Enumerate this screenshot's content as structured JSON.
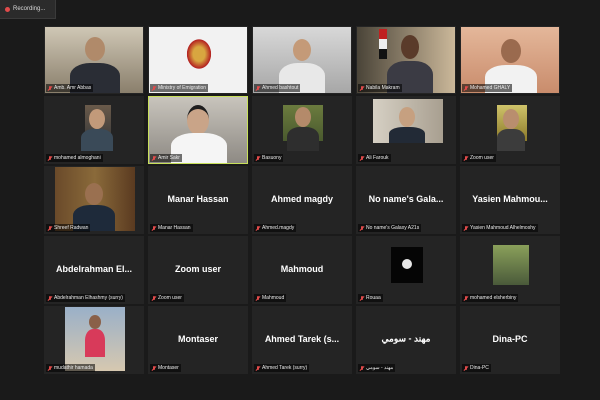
{
  "recording": {
    "label": "Recording..."
  },
  "participants": [
    {
      "label": "Amb. Amr Abbas",
      "name": "",
      "video": true,
      "muted": true
    },
    {
      "label": "Ministry of Emigration",
      "name": "",
      "video": true,
      "muted": true
    },
    {
      "label": "Ahmed bashtout",
      "name": "",
      "video": true,
      "muted": true
    },
    {
      "label": "Nabila Makram",
      "name": "",
      "video": true,
      "muted": true
    },
    {
      "label": "Mohamed GHALY",
      "name": "",
      "video": true,
      "muted": true
    },
    {
      "label": "mohamed almoghani",
      "name": "",
      "video": true,
      "muted": true
    },
    {
      "label": "Amir Sakr",
      "name": "",
      "video": true,
      "muted": true,
      "active": true
    },
    {
      "label": "Basuony",
      "name": "",
      "video": true,
      "muted": true
    },
    {
      "label": "Ali Farouk",
      "name": "",
      "video": true,
      "muted": true
    },
    {
      "label": "Zoom user",
      "name": "",
      "video": true,
      "muted": true
    },
    {
      "label": "Shreef Radwan",
      "name": "",
      "video": true,
      "muted": true
    },
    {
      "label": "Manar Hassan",
      "name": "Manar Hassan",
      "video": false,
      "muted": true
    },
    {
      "label": "Ahmed.magdy",
      "name": "Ahmed magdy",
      "video": false,
      "muted": true
    },
    {
      "label": "No name's Galaxy A21s",
      "name": "No name's Gala...",
      "video": false,
      "muted": true
    },
    {
      "label": "Yasien Mahmoud Alhelmoshy",
      "name": "Yasien Mahmou...",
      "video": false,
      "muted": true
    },
    {
      "label": "Abdelrahman Elhashmy (surry)",
      "name": "Abdelrahman El...",
      "video": false,
      "muted": true
    },
    {
      "label": "Zoom user",
      "name": "Zoom user",
      "video": false,
      "muted": true
    },
    {
      "label": "Mahmoud",
      "name": "Mahmoud",
      "video": false,
      "muted": true
    },
    {
      "label": "Rouaa",
      "name": "",
      "video": false,
      "muted": true,
      "avatar": true
    },
    {
      "label": "mohamed elsherbiny",
      "name": "",
      "video": false,
      "muted": true,
      "avatar": true
    },
    {
      "label": "mudathir hamada",
      "name": "",
      "video": true,
      "muted": true
    },
    {
      "label": "Montaser",
      "name": "Montaser",
      "video": false,
      "muted": true
    },
    {
      "label": "Ahmed Tarek (surry)",
      "name": "Ahmed Tarek (s...",
      "video": false,
      "muted": true
    },
    {
      "label": "مهند - سومي",
      "name": "مهند - سومي",
      "video": false,
      "muted": true
    },
    {
      "label": "Dina-PC",
      "name": "Dina-PC",
      "video": false,
      "muted": true
    }
  ],
  "colors": {
    "active_border": "#c8e05a",
    "mute_red": "#e14b4b"
  }
}
